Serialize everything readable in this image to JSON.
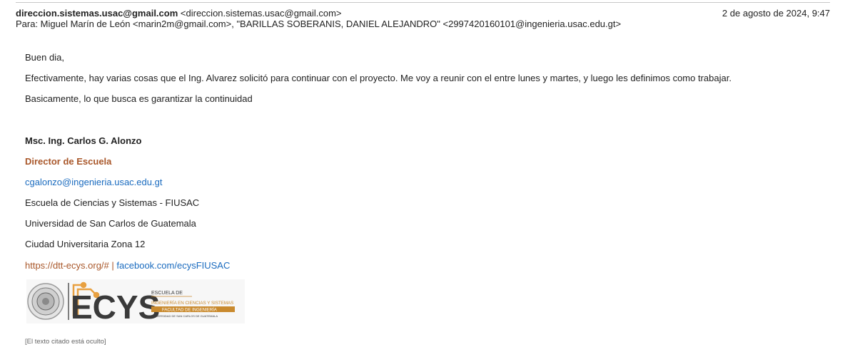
{
  "header": {
    "from_name": "direccion.sistemas.usac@gmail.com",
    "from_email": "<direccion.sistemas.usac@gmail.com>",
    "date": "2 de agosto de 2024, 9:47",
    "to": "Para: Miguel Marín de León <marin2m@gmail.com>, \"BARILLAS SOBERANIS, DANIEL ALEJANDRO\" <2997420160101@ingenieria.usac.edu.gt>"
  },
  "body": {
    "greeting": "Buen dia,",
    "paragraph1": "Efectivamente, hay varias cosas que el Ing. Alvarez solicitó para continuar con el proyecto.  Me voy a reunir con el entre lunes y martes, y luego les definimos como trabajar.",
    "paragraph2": "Basicamente, lo que busca es garantizar la continuidad"
  },
  "signature": {
    "name": "Msc. Ing. Carlos G. Alonzo",
    "title": "Director de Escuela",
    "email": "cgalonzo@ingenieria.usac.edu.gt",
    "school": "Escuela de Ciencias y Sistemas - FIUSAC",
    "university": "Universidad de San Carlos de Guatemala",
    "address": "Ciudad Universitaria Zona 12",
    "site_link": "https://dtt-ecys.org/#",
    "separator": "|",
    "facebook_link": "facebook.com/ecysFIUSAC"
  },
  "logo": {
    "brand": "ECYS",
    "line1": "ESCUELA DE",
    "line2": "INGENIERÍA EN CIENCIAS Y SISTEMAS",
    "line3": "FACULTAD DE INGENIERÍA",
    "line4": "UNIVERSIDAD DE SAN CARLOS DE GUATEMALA",
    "colors": {
      "orange": "#e8a040",
      "dark": "#3a3a3a",
      "gold": "#c98a2e"
    }
  },
  "quoted_text": "[El texto citado está oculto]"
}
